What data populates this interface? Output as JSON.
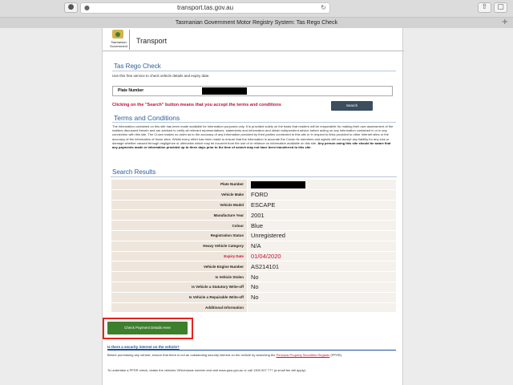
{
  "browser": {
    "url": "transport.tas.gov.au",
    "tab_title": "Tasmanian Government Motor Registry System: Tas Rego Check",
    "new_tab": "+"
  },
  "header": {
    "logo_text": "Tasmanian Government",
    "brand": "Transport"
  },
  "rego_check": {
    "title": "Tas Rego Check",
    "intro": "Use this free service to check vehicle details and expiry date.",
    "plate_label": "Plate Number",
    "warning": "Clicking on the \"Search\" button means that you accept the terms and conditions",
    "search_label": "Search"
  },
  "terms": {
    "title": "Terms and Conditions",
    "body": "The information contained on this site has been made available for information purposes only. It is provided solely on the basis that readers will be responsible for making their own assessment of the matters discussed therein and are advised to verify all relevant representations, statements and information and obtain independent advice before acting on any information contained in or in any connection with this site. The Crown makes no claim as to the accuracy of any information provided by third parties connected to this site or in respect to links provided to other Internet sites or the accuracy of the information of those sites. Whilst every effort has been made to ensure that the information is accurate the Crown its members and agents will not accept any liability for any loss or damage whether caused through negligence or otherwise which may be incurred from the use of or reliance on information available on this site.",
    "bold_line": "Any person using this site should be aware that any payments made or information provided up to three days prior to the time of search may not have been transferred to this site."
  },
  "results": {
    "title": "Search Results",
    "rows": [
      {
        "key": "Plate Number",
        "value": ""
      },
      {
        "key": "Vehicle Make",
        "value": "FORD"
      },
      {
        "key": "Vehicle Model",
        "value": "ESCAPE"
      },
      {
        "key": "Manufacture Year",
        "value": "2001"
      },
      {
        "key": "Colour",
        "value": "Blue"
      },
      {
        "key": "Registration Status",
        "value": "Unregistered"
      },
      {
        "key": "Heavy Vehicle Category",
        "value": "N/A"
      },
      {
        "key": "Expiry Date",
        "value": "01/04/2020"
      },
      {
        "key": "Vehicle Engine Number",
        "value": "AS214101"
      },
      {
        "key": "Is Vehicle Stolen",
        "value": "No"
      },
      {
        "key": "Is Vehicle a Statutory Write-off",
        "value": "No"
      },
      {
        "key": "Is Vehicle a Repairable Write-off",
        "value": "No"
      },
      {
        "key": "Additional Information",
        "value": ""
      }
    ]
  },
  "payment": {
    "button_label": "Check Payment Details Here"
  },
  "security": {
    "link": "Is there a security interest on the vehicle?",
    "p1_pre": "Before purchasing any vehicle, ensure that there is not an outstanding security interest on the vehicle by searching the",
    "p1_link": "Personal Property Securities Register",
    "p1_post": "(PPSR).",
    "p2": "To undertake a PPSR check, obtain the vehicles VIN/chassis number and visit www.ppsr.gov.au or call 1300 007 777 (a small fee will apply)."
  },
  "colors": {
    "accent_blue": "#2a5f99",
    "warning_red": "#c8102e",
    "pay_green": "#3e7f2d",
    "highlight_border": "#e8231f"
  }
}
